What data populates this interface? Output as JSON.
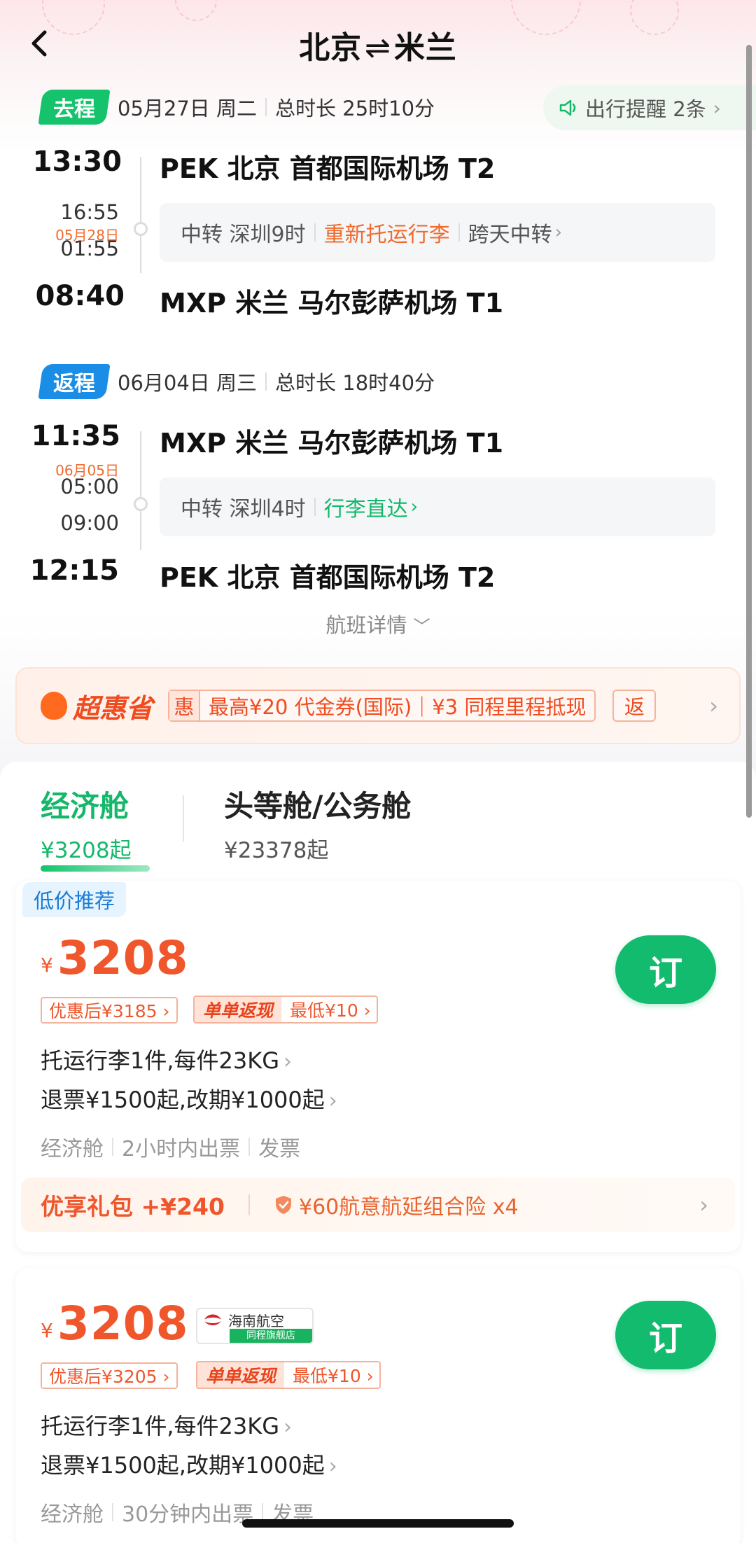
{
  "header": {
    "title_from": "北京",
    "title_arrow": "⇌",
    "title_to": "米兰"
  },
  "reminder": {
    "label": "出行提醒 2条"
  },
  "outbound": {
    "tag": "去程",
    "date": "05月27日 周二",
    "duration": "总时长 25时10分",
    "dep_time": "13:30",
    "dep_airport": "PEK 北京 首都国际机场 T2",
    "transfer_arr": "16:55",
    "transfer_date": "05月28日",
    "transfer_dep": "01:55",
    "transfer_city": "中转 深圳9时",
    "transfer_note": "重新托运行李",
    "transfer_extra": "跨天中转",
    "arr_time": "08:40",
    "arr_airport": "MXP 米兰 马尔彭萨机场 T1"
  },
  "inbound": {
    "tag": "返程",
    "date": "06月04日 周三",
    "duration": "总时长 18时40分",
    "dep_time": "11:35",
    "dep_airport": "MXP 米兰 马尔彭萨机场 T1",
    "transfer_date": "06月05日",
    "transfer_arr": "05:00",
    "transfer_dep": "09:00",
    "transfer_city": "中转 深圳4时",
    "transfer_note": "行李直达",
    "arr_time": "12:15",
    "arr_airport": "PEK 北京 首都国际机场 T2"
  },
  "flight_detail": "航班详情",
  "promo": {
    "logo": "超惠省",
    "hui": "惠",
    "text": "最高¥20 代金券(国际)｜¥3 同程里程抵现",
    "second": "返"
  },
  "cabins": [
    {
      "name": "经济舱",
      "price": "¥3208起"
    },
    {
      "name": "头等舱/公务舱",
      "price": "¥23378起"
    }
  ],
  "fare1": {
    "badge": "低价推荐",
    "yen": "¥",
    "price": "3208",
    "discount": "优惠后¥3185 ›",
    "cashback_tag": "单单返现",
    "cashback_text": "最低¥10 ›",
    "book": "订",
    "baggage": "托运行李1件,每件23KG",
    "refund": "退票¥1500起,改期¥1000起",
    "meta": [
      "经济舱",
      "2小时内出票",
      "发票"
    ],
    "gift_title": "优享礼包 +¥240",
    "gift_desc": "¥60航意航延组合险 x4"
  },
  "fare2": {
    "yen": "¥",
    "price": "3208",
    "airline": "海南航空",
    "airline_sub": "同程旗舰店",
    "discount": "优惠后¥3205 ›",
    "cashback_tag": "单单返现",
    "cashback_text": "最低¥10 ›",
    "book": "订",
    "baggage": "托运行李1件,每件23KG",
    "refund": "退票¥1500起,改期¥1000起",
    "meta": [
      "经济舱",
      "30分钟内出票",
      "发票"
    ]
  }
}
